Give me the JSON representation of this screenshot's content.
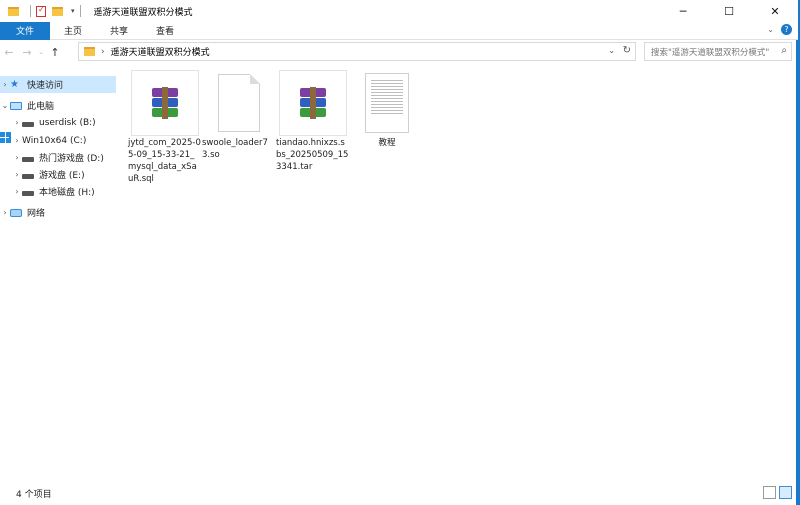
{
  "window": {
    "title": "遥游天道联盟双积分模式",
    "controls": {
      "minimize": "─",
      "maximize": "☐",
      "close": "✕"
    }
  },
  "ribbon": {
    "tabs": [
      "文件",
      "主页",
      "共享",
      "查看"
    ]
  },
  "address": {
    "path": "遥游天道联盟双积分模式",
    "search_placeholder": "搜索\"遥游天道联盟双积分模式\""
  },
  "nav": {
    "quick_access": "快速访问",
    "this_pc": "此电脑",
    "drives": [
      {
        "label": "userdisk (B:)",
        "icon": "drive-icon"
      },
      {
        "label": "Win10x64 (C:)",
        "icon": "windows-drive-icon"
      },
      {
        "label": "热门游戏盘 (D:)",
        "icon": "drive-icon"
      },
      {
        "label": "游戏盘 (E:)",
        "icon": "drive-icon"
      },
      {
        "label": "本地磁盘 (H:)",
        "icon": "drive-icon"
      }
    ],
    "network": "网络"
  },
  "files": [
    {
      "name": "jytd_com_2025-05-09_15-33-21_mysql_data_xSauR.sql",
      "icon": "rar-archive-icon"
    },
    {
      "name": "swoole_loader73.so",
      "icon": "blank-file-icon"
    },
    {
      "name": "tiandao.hnixzs.sbs_20250509_153341.tar",
      "icon": "rar-archive-icon"
    },
    {
      "name": "教程",
      "icon": "text-document-icon"
    }
  ],
  "status": {
    "count": "4 个项目"
  },
  "colors": {
    "accent": "#1979ca",
    "selection": "#cce8ff"
  }
}
